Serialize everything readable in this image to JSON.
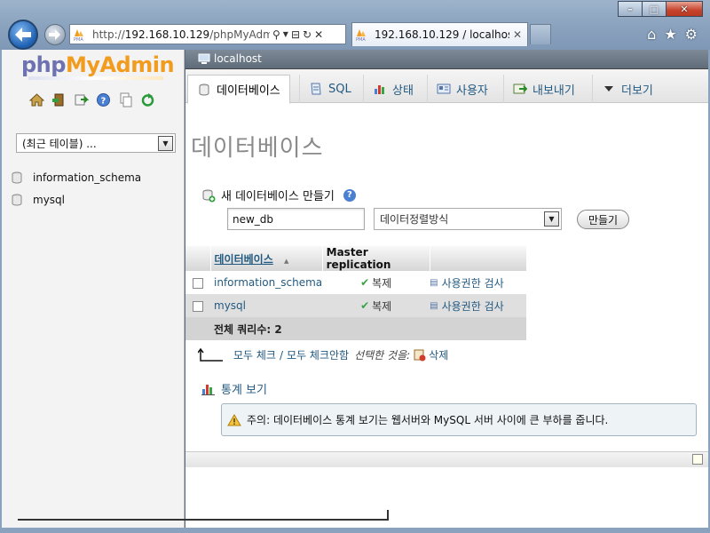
{
  "browser": {
    "address_url_prefix": "http://",
    "address_url_host": "192.168.10.129",
    "address_url_path": "/phpMyAdmin",
    "tab_title": "192.168.10.129 / localhos...",
    "window_buttons": {
      "minimize": "–",
      "maximize": "□",
      "close": "✕"
    },
    "toolbar_icons": [
      "home-icon",
      "star-icon",
      "gear-icon"
    ]
  },
  "nav": {
    "logo_php": "php",
    "logo_myadmin": "MyAdmin",
    "quick_icons": [
      "home-icon",
      "exit-icon",
      "query-icon",
      "docs-icon",
      "copy-icon",
      "reload-icon"
    ],
    "recent_tables": "(최근 테이블) ...",
    "databases": [
      "information_schema",
      "mysql"
    ]
  },
  "server": {
    "breadcrumb": "localhost"
  },
  "tabs": [
    {
      "label": "데이터베이스",
      "icon": "database-icon",
      "active": true
    },
    {
      "label": "SQL",
      "icon": "sql-icon",
      "active": false
    },
    {
      "label": "상태",
      "icon": "status-icon",
      "active": false
    },
    {
      "label": "사용자",
      "icon": "users-icon",
      "active": false
    },
    {
      "label": "내보내기",
      "icon": "export-icon",
      "active": false
    },
    {
      "label": "더보기",
      "icon": "chevron-down-icon",
      "active": false
    }
  ],
  "page": {
    "title": "데이터베이스",
    "create_heading": "새 데이터베이스 만들기",
    "new_db_value": "new_db",
    "collation_placeholder": "데이터정렬방식",
    "create_button": "만들기"
  },
  "table": {
    "headers": {
      "database": "데이터베이스",
      "sort_indicator": "▲",
      "replication": "Master replication"
    },
    "rows": [
      {
        "name": "information_schema",
        "replication": "복제",
        "action": "사용권한 검사"
      },
      {
        "name": "mysql",
        "replication": "복제",
        "action": "사용권한 검사"
      }
    ],
    "total": "전체 쿼리수: 2"
  },
  "bulk": {
    "check_all": "모두 체크",
    "separator": "/",
    "uncheck_all": "모두 체크안함",
    "with_selected": "선택한 것을:",
    "delete": "삭제"
  },
  "stats": {
    "link": "통계 보기",
    "notice": "주의: 데이터베이스 통계 보기는 웹서버와 MySQL 서버 사이에 큰 부하를 줍니다."
  },
  "colors": {
    "link": "#235a81",
    "logo_php": "#6d72b1",
    "logo_myadmin": "#f29c1f",
    "notice_bg": "#eef3f6"
  }
}
